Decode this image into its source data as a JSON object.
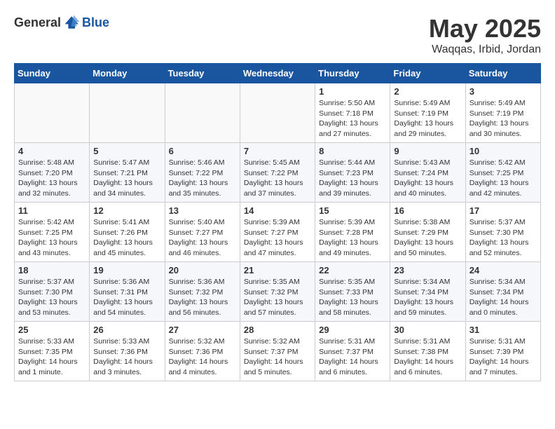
{
  "header": {
    "logo_general": "General",
    "logo_blue": "Blue",
    "month_title": "May 2025",
    "location": "Waqqas, Irbid, Jordan"
  },
  "weekdays": [
    "Sunday",
    "Monday",
    "Tuesday",
    "Wednesday",
    "Thursday",
    "Friday",
    "Saturday"
  ],
  "weeks": [
    [
      {
        "day": "",
        "info": ""
      },
      {
        "day": "",
        "info": ""
      },
      {
        "day": "",
        "info": ""
      },
      {
        "day": "",
        "info": ""
      },
      {
        "day": "1",
        "info": "Sunrise: 5:50 AM\nSunset: 7:18 PM\nDaylight: 13 hours\nand 27 minutes."
      },
      {
        "day": "2",
        "info": "Sunrise: 5:49 AM\nSunset: 7:19 PM\nDaylight: 13 hours\nand 29 minutes."
      },
      {
        "day": "3",
        "info": "Sunrise: 5:49 AM\nSunset: 7:19 PM\nDaylight: 13 hours\nand 30 minutes."
      }
    ],
    [
      {
        "day": "4",
        "info": "Sunrise: 5:48 AM\nSunset: 7:20 PM\nDaylight: 13 hours\nand 32 minutes."
      },
      {
        "day": "5",
        "info": "Sunrise: 5:47 AM\nSunset: 7:21 PM\nDaylight: 13 hours\nand 34 minutes."
      },
      {
        "day": "6",
        "info": "Sunrise: 5:46 AM\nSunset: 7:22 PM\nDaylight: 13 hours\nand 35 minutes."
      },
      {
        "day": "7",
        "info": "Sunrise: 5:45 AM\nSunset: 7:22 PM\nDaylight: 13 hours\nand 37 minutes."
      },
      {
        "day": "8",
        "info": "Sunrise: 5:44 AM\nSunset: 7:23 PM\nDaylight: 13 hours\nand 39 minutes."
      },
      {
        "day": "9",
        "info": "Sunrise: 5:43 AM\nSunset: 7:24 PM\nDaylight: 13 hours\nand 40 minutes."
      },
      {
        "day": "10",
        "info": "Sunrise: 5:42 AM\nSunset: 7:25 PM\nDaylight: 13 hours\nand 42 minutes."
      }
    ],
    [
      {
        "day": "11",
        "info": "Sunrise: 5:42 AM\nSunset: 7:25 PM\nDaylight: 13 hours\nand 43 minutes."
      },
      {
        "day": "12",
        "info": "Sunrise: 5:41 AM\nSunset: 7:26 PM\nDaylight: 13 hours\nand 45 minutes."
      },
      {
        "day": "13",
        "info": "Sunrise: 5:40 AM\nSunset: 7:27 PM\nDaylight: 13 hours\nand 46 minutes."
      },
      {
        "day": "14",
        "info": "Sunrise: 5:39 AM\nSunset: 7:27 PM\nDaylight: 13 hours\nand 47 minutes."
      },
      {
        "day": "15",
        "info": "Sunrise: 5:39 AM\nSunset: 7:28 PM\nDaylight: 13 hours\nand 49 minutes."
      },
      {
        "day": "16",
        "info": "Sunrise: 5:38 AM\nSunset: 7:29 PM\nDaylight: 13 hours\nand 50 minutes."
      },
      {
        "day": "17",
        "info": "Sunrise: 5:37 AM\nSunset: 7:30 PM\nDaylight: 13 hours\nand 52 minutes."
      }
    ],
    [
      {
        "day": "18",
        "info": "Sunrise: 5:37 AM\nSunset: 7:30 PM\nDaylight: 13 hours\nand 53 minutes."
      },
      {
        "day": "19",
        "info": "Sunrise: 5:36 AM\nSunset: 7:31 PM\nDaylight: 13 hours\nand 54 minutes."
      },
      {
        "day": "20",
        "info": "Sunrise: 5:36 AM\nSunset: 7:32 PM\nDaylight: 13 hours\nand 56 minutes."
      },
      {
        "day": "21",
        "info": "Sunrise: 5:35 AM\nSunset: 7:32 PM\nDaylight: 13 hours\nand 57 minutes."
      },
      {
        "day": "22",
        "info": "Sunrise: 5:35 AM\nSunset: 7:33 PM\nDaylight: 13 hours\nand 58 minutes."
      },
      {
        "day": "23",
        "info": "Sunrise: 5:34 AM\nSunset: 7:34 PM\nDaylight: 13 hours\nand 59 minutes."
      },
      {
        "day": "24",
        "info": "Sunrise: 5:34 AM\nSunset: 7:34 PM\nDaylight: 14 hours\nand 0 minutes."
      }
    ],
    [
      {
        "day": "25",
        "info": "Sunrise: 5:33 AM\nSunset: 7:35 PM\nDaylight: 14 hours\nand 1 minute."
      },
      {
        "day": "26",
        "info": "Sunrise: 5:33 AM\nSunset: 7:36 PM\nDaylight: 14 hours\nand 3 minutes."
      },
      {
        "day": "27",
        "info": "Sunrise: 5:32 AM\nSunset: 7:36 PM\nDaylight: 14 hours\nand 4 minutes."
      },
      {
        "day": "28",
        "info": "Sunrise: 5:32 AM\nSunset: 7:37 PM\nDaylight: 14 hours\nand 5 minutes."
      },
      {
        "day": "29",
        "info": "Sunrise: 5:31 AM\nSunset: 7:37 PM\nDaylight: 14 hours\nand 6 minutes."
      },
      {
        "day": "30",
        "info": "Sunrise: 5:31 AM\nSunset: 7:38 PM\nDaylight: 14 hours\nand 6 minutes."
      },
      {
        "day": "31",
        "info": "Sunrise: 5:31 AM\nSunset: 7:39 PM\nDaylight: 14 hours\nand 7 minutes."
      }
    ]
  ]
}
